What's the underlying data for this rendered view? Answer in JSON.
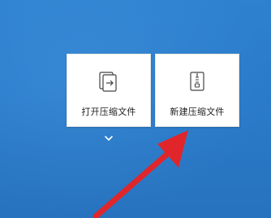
{
  "desktop": {
    "tiles": [
      {
        "label": "打开压缩文件",
        "icon": "open-archive-icon"
      },
      {
        "label": "新建压缩文件",
        "icon": "new-archive-icon"
      }
    ],
    "expand_icon": "chevron-down-icon",
    "annotation_arrow_color": "#e0262a",
    "accent": "#2f86d6"
  }
}
